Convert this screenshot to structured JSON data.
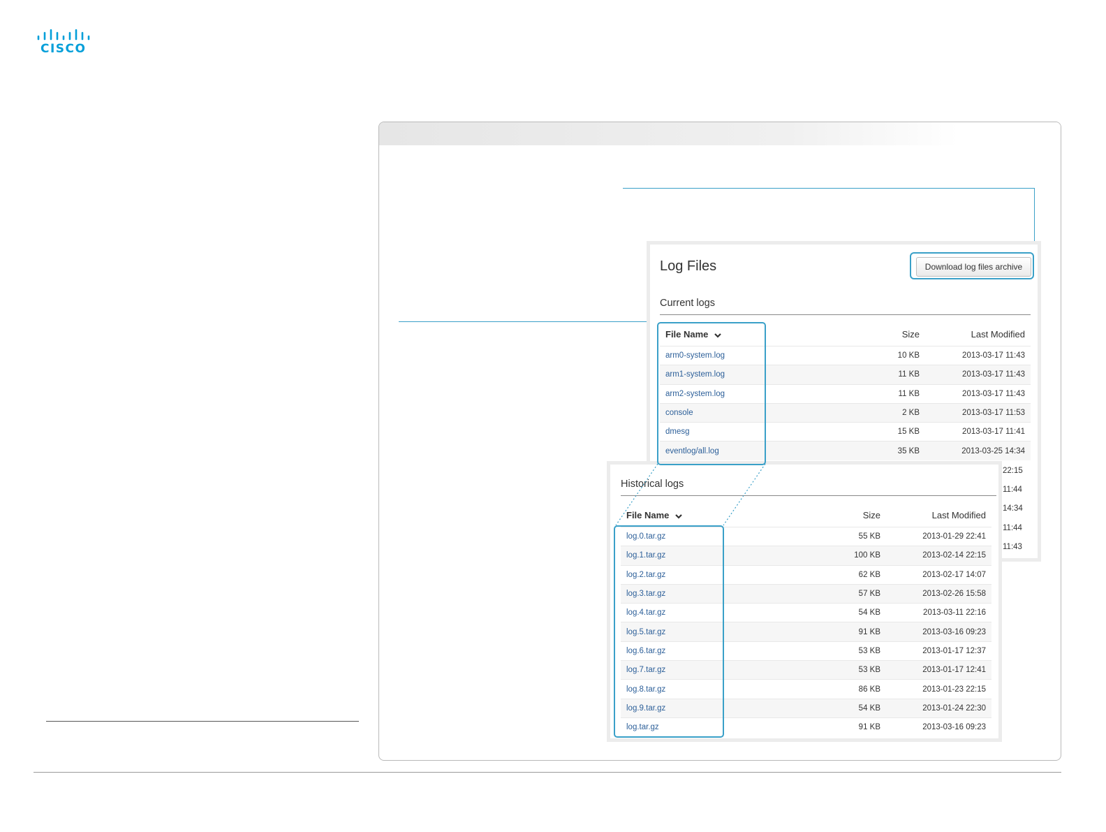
{
  "logo": {
    "text": "CISCO"
  },
  "current_card": {
    "title": "Log Files",
    "download_button": "Download log files archive",
    "section_title": "Current logs",
    "columns": {
      "file_name": "File Name",
      "size": "Size",
      "modified": "Last Modified"
    },
    "rows": [
      {
        "name": "arm0-system.log",
        "size": "10 KB",
        "modified": "2013-03-17 11:43"
      },
      {
        "name": "arm1-system.log",
        "size": "11 KB",
        "modified": "2013-03-17 11:43"
      },
      {
        "name": "arm2-system.log",
        "size": "11 KB",
        "modified": "2013-03-17 11:43"
      },
      {
        "name": "console",
        "size": "2 KB",
        "modified": "2013-03-17 11:53"
      },
      {
        "name": "dmesg",
        "size": "15 KB",
        "modified": "2013-03-17 11:41"
      },
      {
        "name": "eventlog/all.log",
        "size": "35 KB",
        "modified": "2013-03-25 14:34"
      }
    ],
    "hidden_times": [
      "22:15",
      "11:44",
      "14:34",
      "11:44",
      "11:43"
    ]
  },
  "historical_card": {
    "section_title": "Historical logs",
    "columns": {
      "file_name": "File Name",
      "size": "Size",
      "modified": "Last Modified"
    },
    "rows": [
      {
        "name": "log.0.tar.gz",
        "size": "55 KB",
        "modified": "2013-01-29 22:41"
      },
      {
        "name": "log.1.tar.gz",
        "size": "100 KB",
        "modified": "2013-02-14 22:15"
      },
      {
        "name": "log.2.tar.gz",
        "size": "62 KB",
        "modified": "2013-02-17 14:07"
      },
      {
        "name": "log.3.tar.gz",
        "size": "57 KB",
        "modified": "2013-02-26 15:58"
      },
      {
        "name": "log.4.tar.gz",
        "size": "54 KB",
        "modified": "2013-03-11 22:16"
      },
      {
        "name": "log.5.tar.gz",
        "size": "91 KB",
        "modified": "2013-03-16 09:23"
      },
      {
        "name": "log.6.tar.gz",
        "size": "53 KB",
        "modified": "2013-01-17 12:37"
      },
      {
        "name": "log.7.tar.gz",
        "size": "53 KB",
        "modified": "2013-01-17 12:41"
      },
      {
        "name": "log.8.tar.gz",
        "size": "86 KB",
        "modified": "2013-01-23 22:15"
      },
      {
        "name": "log.9.tar.gz",
        "size": "54 KB",
        "modified": "2013-01-24 22:30"
      },
      {
        "name": "log.tar.gz",
        "size": "91 KB",
        "modified": "2013-03-16 09:23"
      }
    ]
  },
  "colors": {
    "brand": "#049fd9",
    "callout": "#3aa0c8",
    "link": "#2c5f99"
  }
}
